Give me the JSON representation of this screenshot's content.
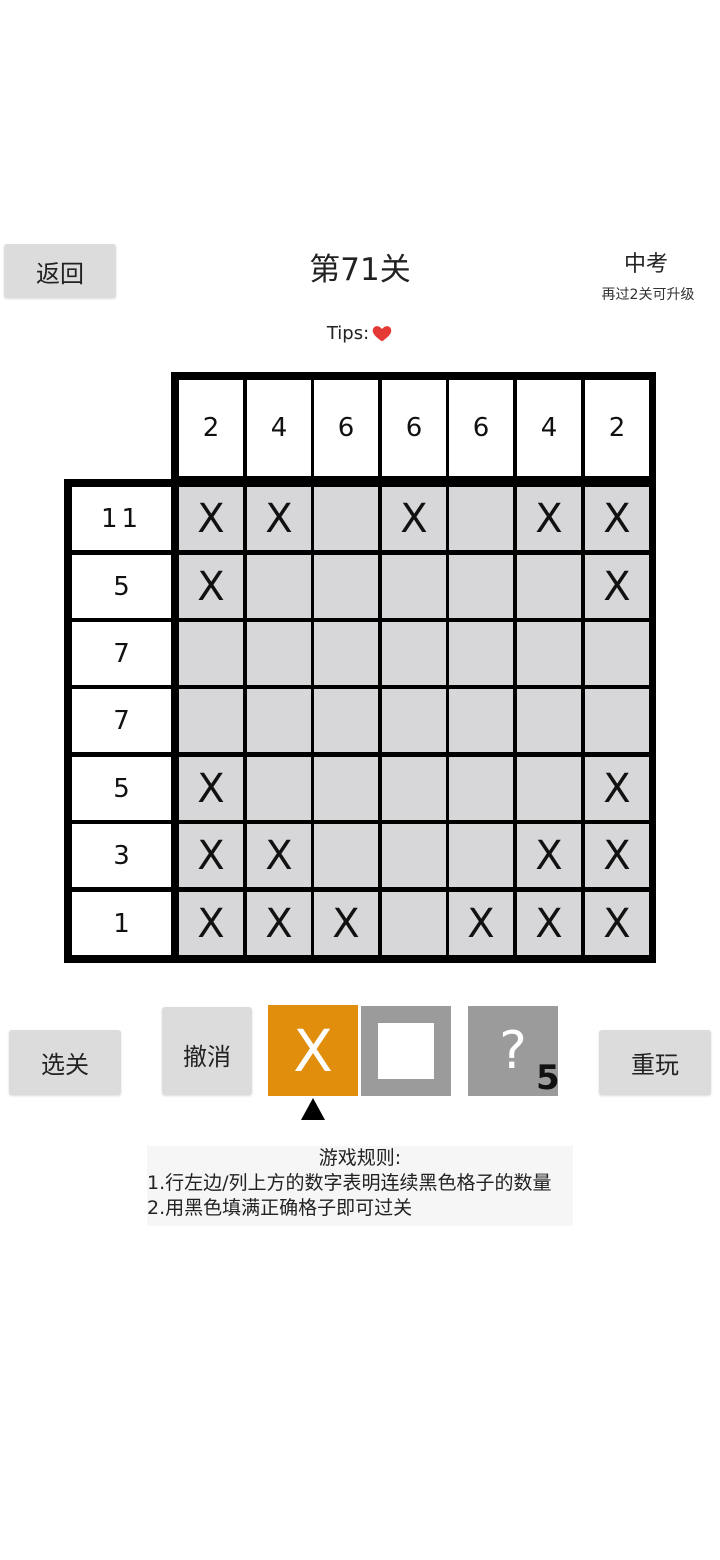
{
  "header": {
    "back_label": "返回",
    "title": "第71关",
    "rank": "中考",
    "rank_sub": "再过2关可升级",
    "tips_label": "Tips:",
    "tips_icon": "heart-icon",
    "heart_color": "#e53935"
  },
  "puzzle": {
    "col_clues": [
      "2",
      "4",
      "6",
      "6",
      "6",
      "4",
      "2"
    ],
    "row_clues": [
      "11",
      "5",
      "7",
      "7",
      "5",
      "3",
      "1"
    ],
    "cells": [
      [
        "X",
        "X",
        "",
        "X",
        "",
        "X",
        "X"
      ],
      [
        "X",
        "",
        "",
        "",
        "",
        "",
        "X"
      ],
      [
        "",
        "",
        "",
        "",
        "",
        "",
        ""
      ],
      [
        "",
        "",
        "",
        "",
        "",
        "",
        ""
      ],
      [
        "X",
        "",
        "",
        "",
        "",
        "",
        "X"
      ],
      [
        "X",
        "X",
        "",
        "",
        "",
        "X",
        "X"
      ],
      [
        "X",
        "X",
        "X",
        "",
        "X",
        "X",
        "X"
      ]
    ]
  },
  "controls": {
    "select_label": "选关",
    "undo_label": "撤消",
    "mode_x_label": "X",
    "mode_fill_icon": "square-icon",
    "hint_label": "?",
    "hint_count": "5",
    "restart_label": "重玩",
    "active_mode": "X",
    "accent_color": "#e08e0b"
  },
  "rules": {
    "title": "游戏规则:",
    "items": [
      "1.行左边/列上方的数字表明连续黑色格子的数量",
      "2.用黑色填满正确格子即可过关"
    ]
  }
}
